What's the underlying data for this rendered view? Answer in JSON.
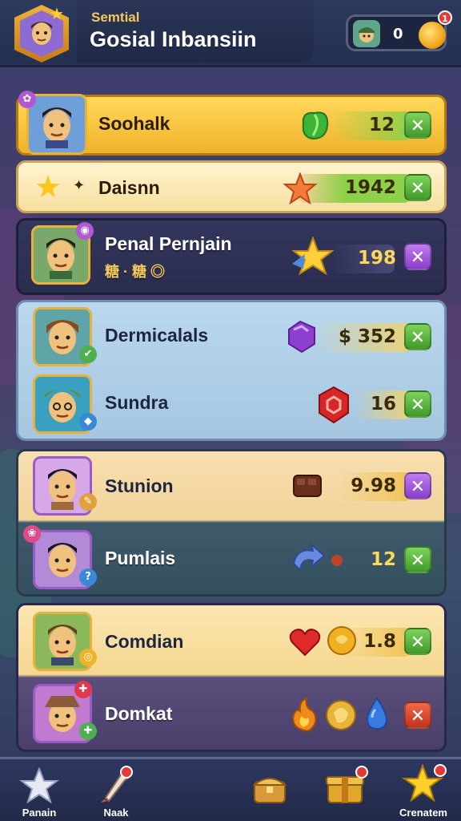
{
  "header": {
    "subtitle": "Semtial",
    "title": "Gosial Inbansiin",
    "currency_value": "0",
    "currency_badge": "1"
  },
  "rows": [
    {
      "name": "Soohalk",
      "value": "12",
      "action": "✕",
      "icon": "green-gem-icon"
    },
    {
      "name": "Daisnn",
      "value": "1942",
      "action": "✕",
      "icon": "star-icon"
    },
    {
      "name": "Penal Pernjain",
      "value": "198",
      "action": "✕",
      "icon": "gold-star-icon",
      "sub": "糖 · 糖 ◎"
    },
    {
      "name": "Dermicalals",
      "value": "$ 352",
      "action": "✕",
      "icon": "purple-gem-icon"
    },
    {
      "name": "Sundra",
      "value": "16",
      "action": "✕",
      "icon": "red-gem-icon"
    },
    {
      "name": "Stunion",
      "value": "9.98",
      "action": "✕",
      "icon": "chocolate-icon"
    },
    {
      "name": "Pumlais",
      "value": "12",
      "action": "✕",
      "icon": "arrow-icon"
    },
    {
      "name": "Comdian",
      "value": "1.8",
      "action": "✕",
      "icon": "heart-icon"
    },
    {
      "name": "Domkat",
      "value": "",
      "action": "✕",
      "icon": "fire-icon"
    }
  ],
  "nav": [
    {
      "label": "Panain",
      "icon": "star-icon"
    },
    {
      "label": "Naak",
      "icon": "rocket-icon"
    },
    {
      "label": "",
      "icon": "chest-icon"
    },
    {
      "label": "",
      "icon": "gift-icon"
    },
    {
      "label": "Crenatem",
      "icon": "gold-star-icon"
    }
  ],
  "colors": {
    "accent": "#f4c85a",
    "green": "#4caf50",
    "purple": "#9b51e0"
  }
}
